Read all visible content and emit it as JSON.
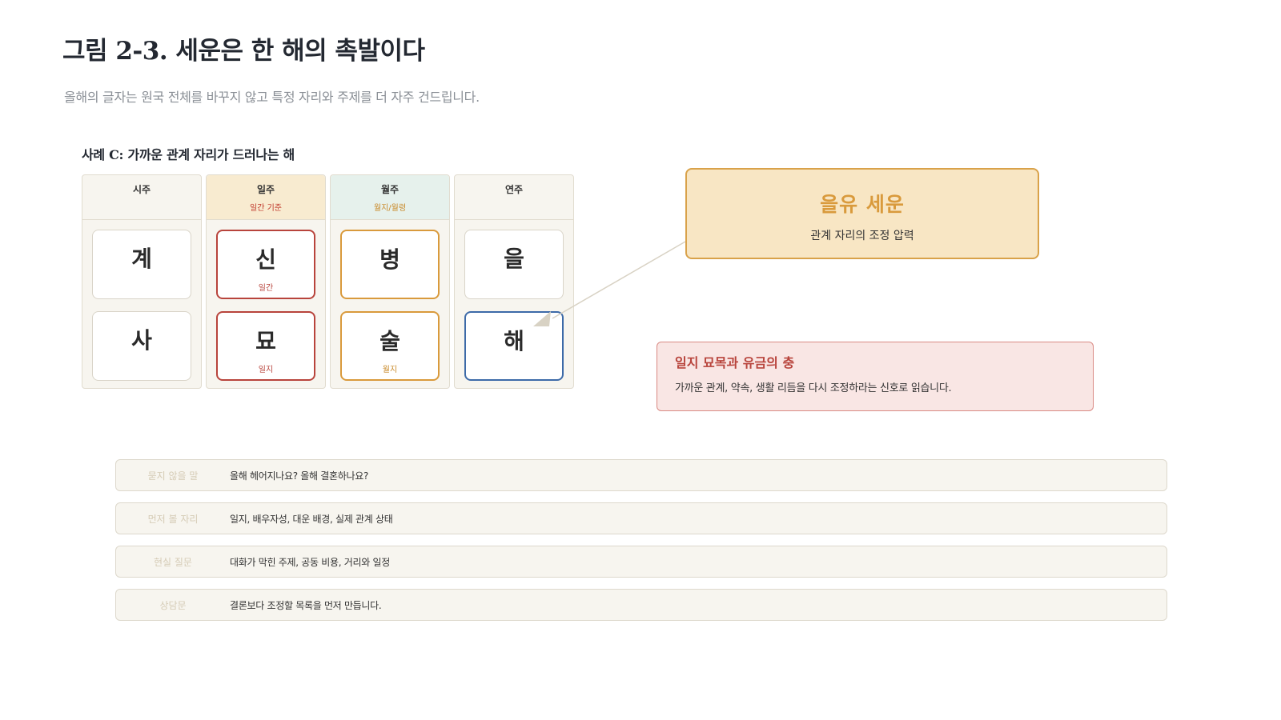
{
  "header": {
    "title": "그림 2-3. 세운은 한 해의 촉발이다",
    "subtitle": "올해의 글자는 원국 전체를 바꾸지 않고 특정 자리와 주제를 더 자주 건드립니다."
  },
  "case": {
    "title": "사례 C: 가까운 관계 자리가 드러나는 해"
  },
  "pillars": [
    {
      "label": "시주",
      "sub": "",
      "stem": "계",
      "stem_note": "",
      "branch": "사",
      "branch_note": ""
    },
    {
      "label": "일주",
      "sub": "일간 기준",
      "stem": "신",
      "stem_note": "일간",
      "branch": "묘",
      "branch_note": "일지"
    },
    {
      "label": "월주",
      "sub": "월지/월령",
      "stem": "병",
      "stem_note": "",
      "branch": "술",
      "branch_note": "월지"
    },
    {
      "label": "연주",
      "sub": "",
      "stem": "을",
      "stem_note": "",
      "branch": "해",
      "branch_note": ""
    }
  ],
  "callout_main": {
    "title": "을유 세운",
    "subtitle": "관계 자리의 조정 압력"
  },
  "callout_alert": {
    "title": "일지 묘목과 유금의 충",
    "body": "가까운 관계, 약속, 생활 리듬을 다시 조정하라는 신호로 읽습니다."
  },
  "rows": [
    {
      "label": "묻지 않을 말",
      "text": "올해 헤어지나요? 올해 결혼하나요?"
    },
    {
      "label": "먼저 볼 자리",
      "text": "일지, 배우자성, 대운 배경, 실제 관계 상태"
    },
    {
      "label": "현실 질문",
      "text": "대화가 막힌 주제, 공동 비용, 거리와 일정"
    },
    {
      "label": "상담문",
      "text": "결론보다 조정할 목록을 먼저 만듭니다."
    }
  ],
  "colors": {
    "day_accent": "#b8443c",
    "month_accent": "#d99a3c",
    "year_branch_accent": "#3d6aa8",
    "callout_main_bg": "#f8e6c4",
    "callout_alert_bg": "#f9e6e4"
  }
}
